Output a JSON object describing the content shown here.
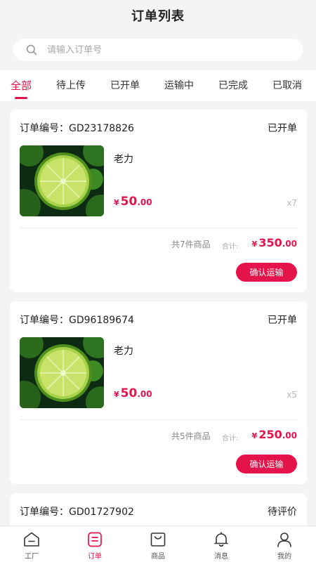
{
  "header": {
    "title": "订单列表"
  },
  "search": {
    "placeholder": "请输入订单号"
  },
  "tabs": [
    {
      "label": "全部",
      "active": true
    },
    {
      "label": "待上传",
      "active": false
    },
    {
      "label": "已开单",
      "active": false
    },
    {
      "label": "运输中",
      "active": false
    },
    {
      "label": "已完成",
      "active": false
    },
    {
      "label": "已取消",
      "active": false
    }
  ],
  "orders": [
    {
      "order_no": "订单编号：GD23178826",
      "status": "已开单",
      "product_name": "老力",
      "price_currency": "¥",
      "price_int": "50",
      "price_dec": ".00",
      "quantity": "x7",
      "count_text": "共7件商品",
      "total_label": "合计:",
      "total_currency": "¥",
      "total_int": "350",
      "total_dec": ".00",
      "action_label": "确认运输"
    },
    {
      "order_no": "订单编号：GD96189674",
      "status": "已开单",
      "product_name": "老力",
      "price_currency": "¥",
      "price_int": "50",
      "price_dec": ".00",
      "quantity": "x5",
      "count_text": "共5件商品",
      "total_label": "合计:",
      "total_currency": "¥",
      "total_int": "250",
      "total_dec": ".00",
      "action_label": "确认运输"
    },
    {
      "order_no": "订单编号：GD01727902",
      "status": "待评价"
    }
  ],
  "tabbar": [
    {
      "label": "工厂",
      "icon": "factory-icon",
      "active": false
    },
    {
      "label": "订单",
      "icon": "order-icon",
      "active": true
    },
    {
      "label": "商品",
      "icon": "goods-bag-icon",
      "active": false
    },
    {
      "label": "消息",
      "icon": "bell-icon",
      "active": false
    },
    {
      "label": "我的",
      "icon": "profile-icon",
      "active": false
    }
  ],
  "colors": {
    "accent": "#e5134b",
    "background": "#f4f4f4",
    "card": "#ffffff",
    "muted": "#888888"
  }
}
